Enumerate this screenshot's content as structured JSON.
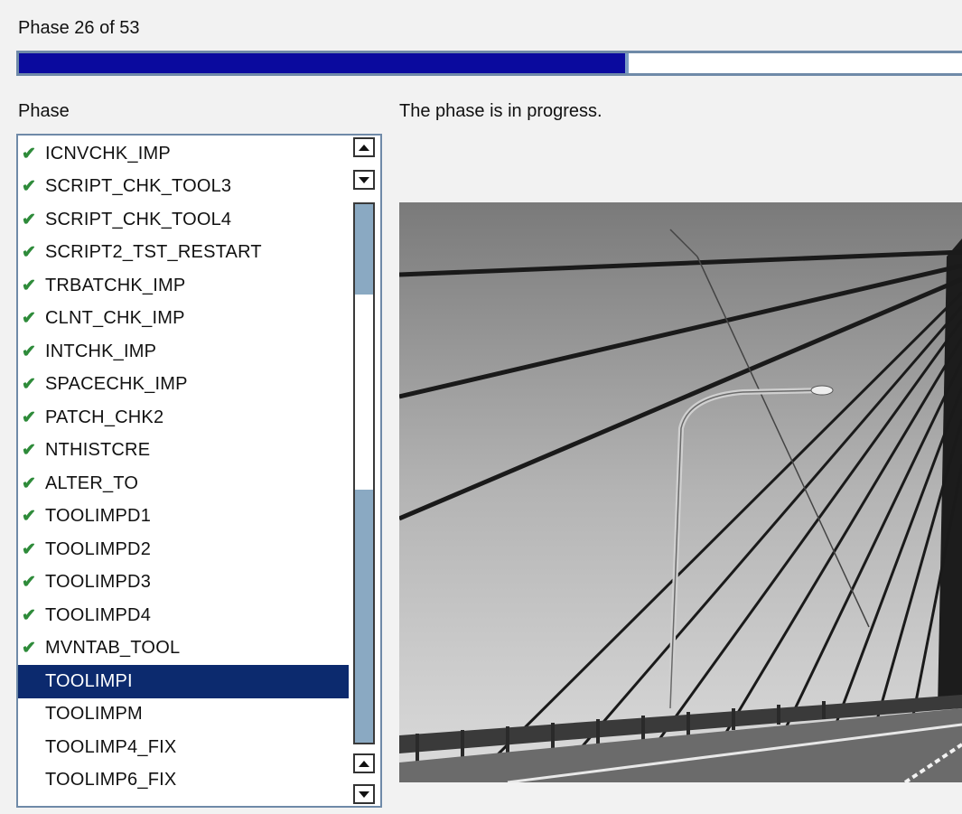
{
  "header": {
    "phase_counter": "Phase 26 of 53",
    "progress_percent": 64,
    "status": "The phase is in progress."
  },
  "list": {
    "title": "Phase",
    "items": [
      {
        "label": "ICNVCHK_IMP",
        "done": true
      },
      {
        "label": "SCRIPT_CHK_TOOL3",
        "done": true
      },
      {
        "label": "SCRIPT_CHK_TOOL4",
        "done": true
      },
      {
        "label": "SCRIPT2_TST_RESTART",
        "done": true
      },
      {
        "label": "TRBATCHK_IMP",
        "done": true
      },
      {
        "label": "CLNT_CHK_IMP",
        "done": true
      },
      {
        "label": "INTCHK_IMP",
        "done": true
      },
      {
        "label": "SPACECHK_IMP",
        "done": true
      },
      {
        "label": "PATCH_CHK2",
        "done": true
      },
      {
        "label": "NTHISTCRE",
        "done": true
      },
      {
        "label": "ALTER_TO",
        "done": true
      },
      {
        "label": "TOOLIMPD1",
        "done": true
      },
      {
        "label": "TOOLIMPD2",
        "done": true
      },
      {
        "label": "TOOLIMPD3",
        "done": true
      },
      {
        "label": "TOOLIMPD4",
        "done": true
      },
      {
        "label": "MVNTAB_TOOL",
        "done": true
      },
      {
        "label": "TOOLIMPI",
        "done": false,
        "selected": true
      },
      {
        "label": "TOOLIMPM",
        "done": false
      },
      {
        "label": "TOOLIMP4_FIX",
        "done": false
      },
      {
        "label": "TOOLIMP6_FIX",
        "done": false
      }
    ]
  },
  "colors": {
    "progress_fill": "#0a0a9e",
    "selected_row": "#0c2a6e",
    "check": "#2e8b3a"
  }
}
